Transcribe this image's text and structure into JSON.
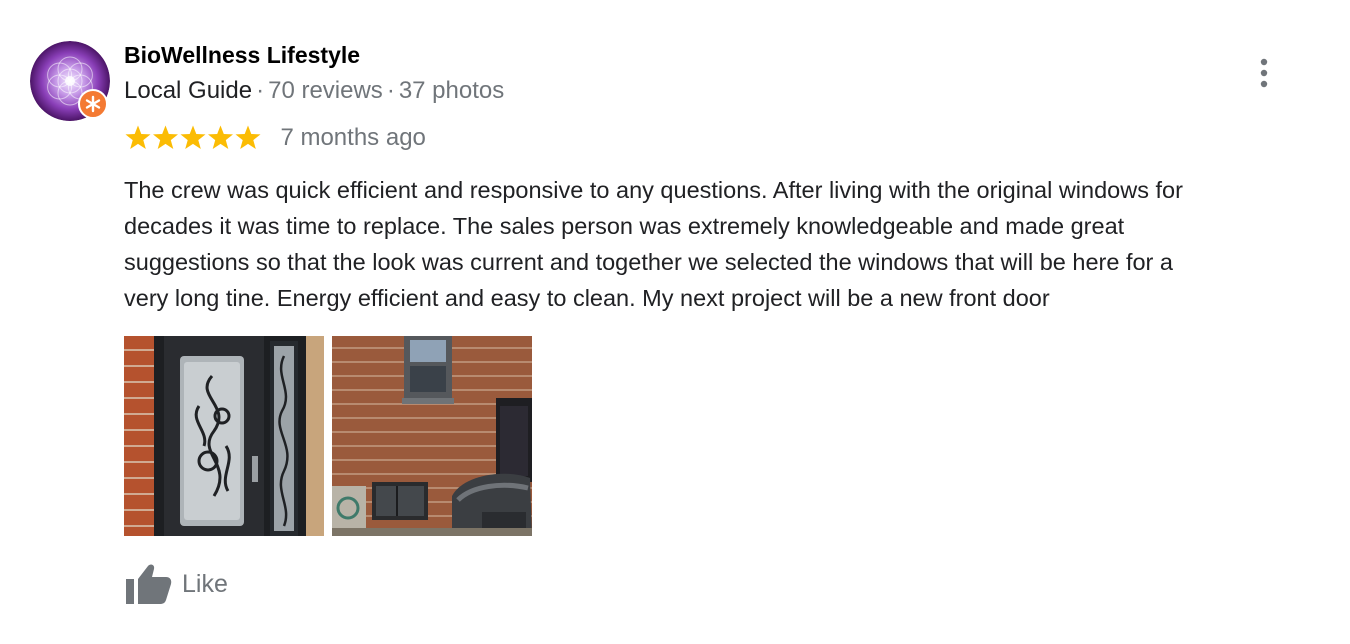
{
  "review": {
    "author_name": "BioWellness Lifestyle",
    "author_level": "Local Guide",
    "reviews_count": "70 reviews",
    "photos_count": "37 photos",
    "separator": "·",
    "rating": 5,
    "rating_max": 5,
    "time_ago": "7 months ago",
    "text": "The crew was quick efficient and responsive to any questions. After living with the original windows for\ndecades it was time to replace. The sales person was extremely knowledgeable and made great\nsuggestions so that the  look was current and together we selected the windows that will be here for a\nvery long tine. Energy efficient and easy to clean. My next project will be a new front door",
    "like_label": "Like"
  },
  "icons": {
    "avatar": "avatar-image",
    "badge": "local-guide-badge-icon",
    "more": "more-vert-icon",
    "star": "star-icon",
    "like": "thumb-up-icon"
  },
  "colors": {
    "star": "#fbbc04",
    "secondary_text": "#70757a",
    "primary_text": "#202124",
    "badge": "#f47a33"
  }
}
